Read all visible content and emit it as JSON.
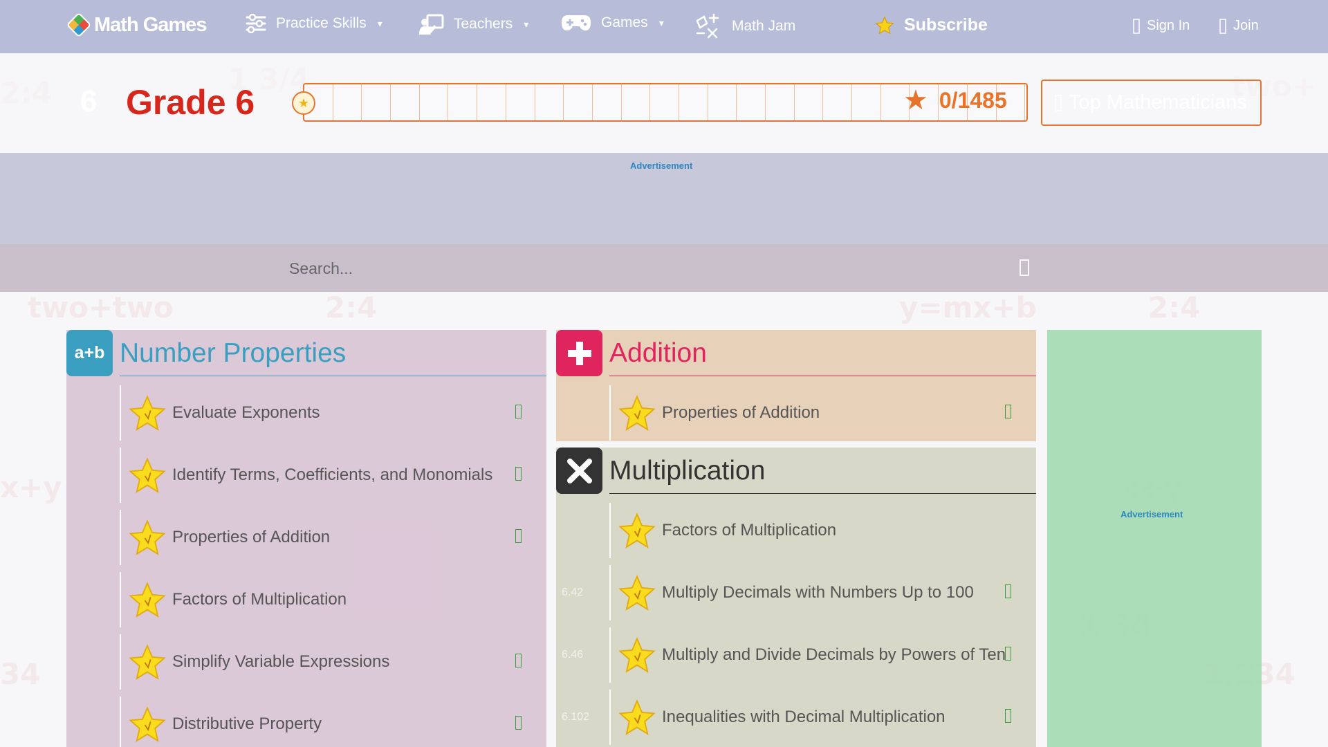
{
  "nav": {
    "logo_text": "Math Games",
    "practice_skills": "Practice Skills",
    "teachers": "Teachers",
    "games": "Games",
    "math_jam": "Math Jam",
    "subscribe": "Subscribe",
    "sign_in": "Sign In",
    "join": "Join"
  },
  "grade": {
    "number": "6",
    "title": "Grade 6",
    "score": "0/1485",
    "progress_fraction": 0,
    "top_mathematicians": "Top Mathematicians"
  },
  "ads": {
    "label": "Advertisement"
  },
  "search": {
    "placeholder": "Search..."
  },
  "sections": {
    "number_properties": {
      "title": "Number Properties",
      "icon_text": "a+b",
      "color": "#3a9ec1",
      "skills": [
        "Evaluate Exponents",
        "Identify Terms, Coefficients, and Monomials",
        "Properties of Addition",
        "Factors of Multiplication",
        "Simplify Variable Expressions",
        "Distributive Property"
      ]
    },
    "addition": {
      "title": "Addition",
      "color": "#e0245e",
      "skills": [
        "Properties of Addition"
      ]
    },
    "multiplication": {
      "title": "Multiplication",
      "color": "#333333",
      "codes": [
        "6.42",
        "6.46",
        "6.102"
      ],
      "skills": [
        "Factors of Multiplication",
        "Multiply Decimals with Numbers Up to 100",
        "Multiply and Divide Decimals by Powers of Ten",
        "Inequalities with Decimal Multiplication"
      ]
    }
  }
}
